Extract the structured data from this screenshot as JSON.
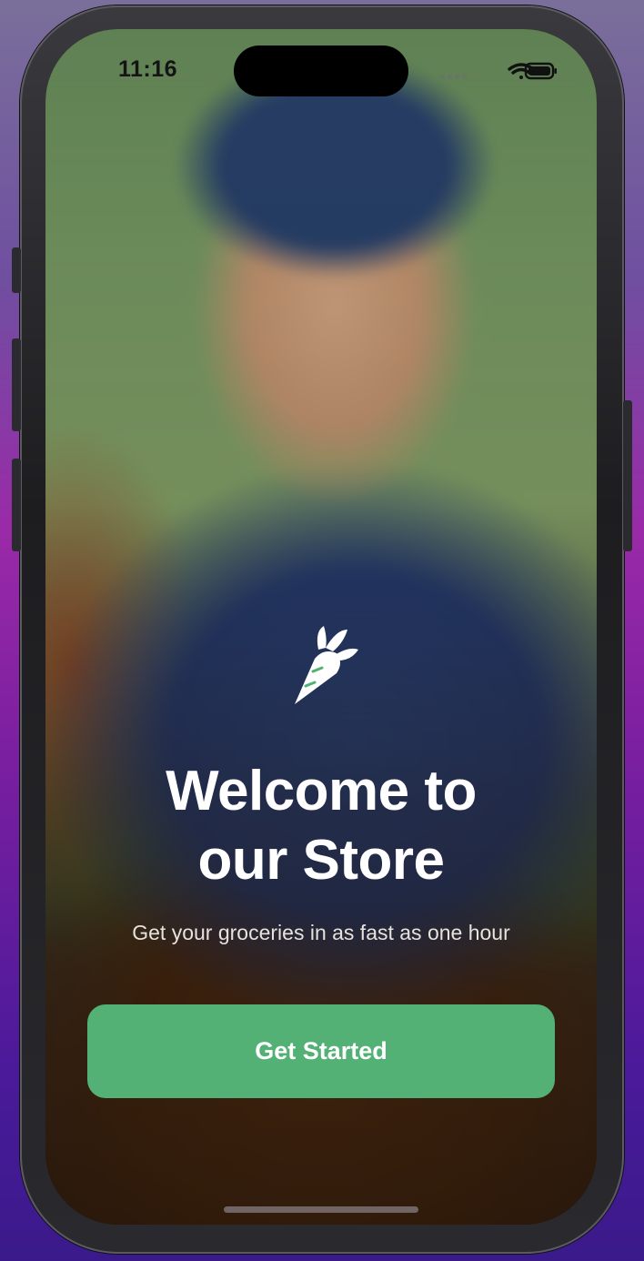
{
  "status_bar": {
    "time": "11:16",
    "signal_icon": "cellular-signal-icon",
    "wifi_icon": "wifi-icon",
    "battery_icon": "battery-icon"
  },
  "onboarding": {
    "logo_icon": "carrot-logo-icon",
    "title_line1": "Welcome to",
    "title_line2": "our Store",
    "subtitle": "Get your groceries in as fast as one hour",
    "cta_label": "Get Started"
  },
  "colors": {
    "accent": "#53b175",
    "text_primary": "#ffffff"
  }
}
